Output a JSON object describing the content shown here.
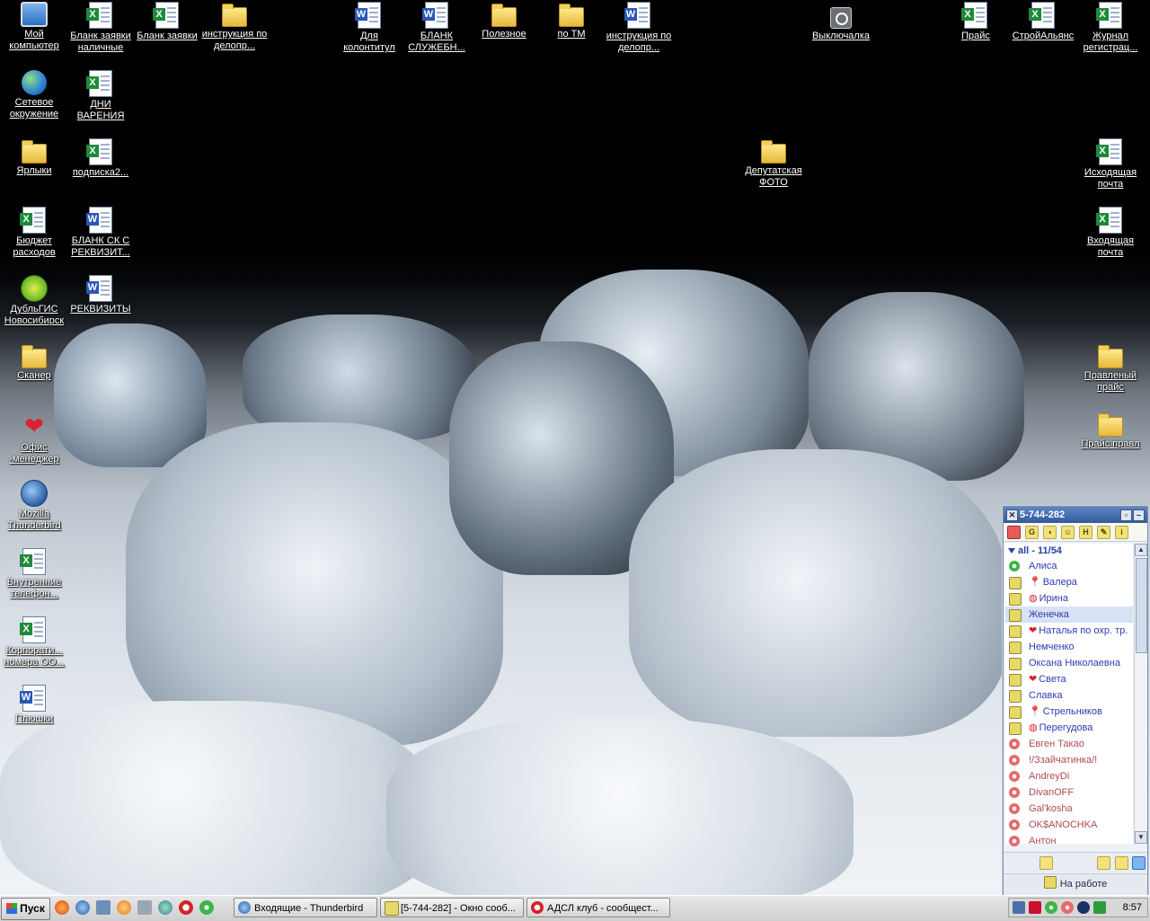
{
  "desktop": {
    "icons": [
      {
        "label": "Мой компьютер",
        "icon": "computer-icon"
      },
      {
        "label": "Бланк заявки наличные",
        "icon": "excel-file-icon"
      },
      {
        "label": "Бланк заявки",
        "icon": "excel-file-icon"
      },
      {
        "label": "инструкция по делопр...",
        "icon": "folder-icon"
      },
      {
        "label": "Для колонтитул",
        "icon": "word-file-icon"
      },
      {
        "label": "БЛАНК СЛУЖЕБН...",
        "icon": "word-file-icon"
      },
      {
        "label": "Полезное",
        "icon": "folder-icon"
      },
      {
        "label": "по ТМ",
        "icon": "folder-icon"
      },
      {
        "label": "инструкция по делопр...",
        "icon": "word-file-icon"
      },
      {
        "label": "Выключалка",
        "icon": "power-icon"
      },
      {
        "label": "Прайс",
        "icon": "excel-file-icon"
      },
      {
        "label": "СтройАльянс",
        "icon": "excel-file-icon"
      },
      {
        "label": "Журнал регистрац...",
        "icon": "excel-file-icon"
      },
      {
        "label": "Сетевое окружение",
        "icon": "network-icon"
      },
      {
        "label": "ДНИ ВАРЕНИЯ",
        "icon": "excel-file-icon"
      },
      {
        "label": "Ярлыки",
        "icon": "folder-icon"
      },
      {
        "label": "подписка2...",
        "icon": "excel-file-icon"
      },
      {
        "label": "Депутатская ФОТО",
        "icon": "folder-icon"
      },
      {
        "label": "Исходящая почта",
        "icon": "excel-file-icon"
      },
      {
        "label": "Бюджет расходов",
        "icon": "excel-file-icon"
      },
      {
        "label": "БЛАНК СК С РЕКВИЗИТ...",
        "icon": "word-file-icon"
      },
      {
        "label": "Входящая почта",
        "icon": "excel-file-icon"
      },
      {
        "label": "ДубльГИС Новосибирск",
        "icon": "dublgis-icon"
      },
      {
        "label": "РЕКВИЗИТЫ",
        "icon": "word-file-icon"
      },
      {
        "label": "Сканер",
        "icon": "folder-icon"
      },
      {
        "label": "Правленый прайс",
        "icon": "folder-icon"
      },
      {
        "label": "Прайс правл",
        "icon": "folder-icon"
      },
      {
        "label": "Офис -менеджер",
        "icon": "heart-icon"
      },
      {
        "label": "Mozilla Thunderbird",
        "icon": "thunderbird-icon"
      },
      {
        "label": "Внутренние телефон...",
        "icon": "excel-file-icon"
      },
      {
        "label": "Корпорати... номера ОО...",
        "icon": "excel-file-icon"
      },
      {
        "label": "Плюшки",
        "icon": "word-file-icon"
      }
    ]
  },
  "icq": {
    "title": "5-744-282",
    "group": "all - 11/54",
    "contacts": [
      {
        "name": "Алиса",
        "status": "online",
        "extra": ""
      },
      {
        "name": "Валера",
        "status": "work",
        "extra": "pin"
      },
      {
        "name": "Ирина",
        "status": "work",
        "extra": "globe"
      },
      {
        "name": "Женечка",
        "status": "work",
        "extra": "",
        "selected": true
      },
      {
        "name": "Наталья по охр. тр.",
        "status": "work",
        "extra": "heart"
      },
      {
        "name": "Немченко",
        "status": "work",
        "extra": ""
      },
      {
        "name": "Оксана Николаевна",
        "status": "work",
        "extra": ""
      },
      {
        "name": "Света",
        "status": "work",
        "extra": "heart"
      },
      {
        "name": "Славка",
        "status": "work",
        "extra": ""
      },
      {
        "name": "Стрельников",
        "status": "work",
        "extra": "pin"
      },
      {
        "name": "Перегудова",
        "status": "work",
        "extra": "globe"
      },
      {
        "name": "Евген Такао",
        "status": "offline",
        "extra": ""
      },
      {
        "name": "!/Ззайчатинка/!",
        "status": "offline",
        "extra": ""
      },
      {
        "name": "AndreyDi",
        "status": "offline",
        "extra": ""
      },
      {
        "name": "DivanOFF",
        "status": "offline",
        "extra": ""
      },
      {
        "name": "Gal'kosha",
        "status": "offline",
        "extra": ""
      },
      {
        "name": "OK$ANOCHKA",
        "status": "offline",
        "extra": ""
      },
      {
        "name": "Антон",
        "status": "offline",
        "extra": ""
      }
    ],
    "status_label": "На работе"
  },
  "taskbar": {
    "start_label": "Пуск",
    "tasks": [
      {
        "label": "Входящие - Thunderbird"
      },
      {
        "label": "[5-744-282] - Окно сооб..."
      },
      {
        "label": "АДСЛ клуб - сообщест..."
      }
    ],
    "clock": "8:57"
  }
}
